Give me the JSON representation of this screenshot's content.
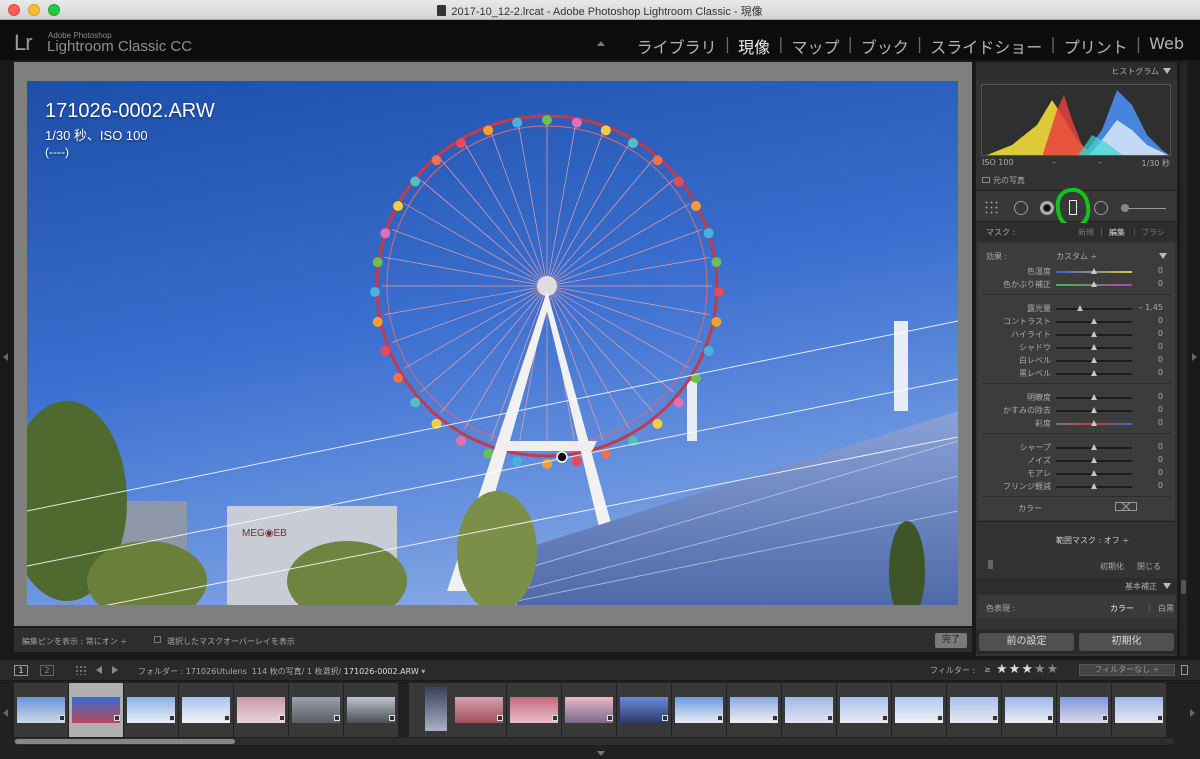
{
  "window": {
    "title": "2017-10_12-2.lrcat - Adobe Photoshop Lightroom Classic - 現像"
  },
  "identity": {
    "logo": "Lr",
    "brand_small": "Adobe Photoshop",
    "brand_big": "Lightroom Classic CC"
  },
  "modules": [
    {
      "label": "ライブラリ",
      "active": false
    },
    {
      "label": "現像",
      "active": true
    },
    {
      "label": "マップ",
      "active": false
    },
    {
      "label": "ブック",
      "active": false
    },
    {
      "label": "スライドショー",
      "active": false
    },
    {
      "label": "プリント",
      "active": false
    },
    {
      "label": "Web",
      "active": false
    }
  ],
  "module_separator": "|",
  "photo_info": {
    "filename": "171026-0002.ARW",
    "exposure": "1/30 秒、ISO 100",
    "extra": "(----)"
  },
  "toolbar": {
    "show_pins_label": "編集ピンを表示 :",
    "show_pins_value": "常にオン",
    "show_pins_arrow": "÷",
    "overlay_label": "選択したマスクオーバーレイを表示",
    "done": "完了"
  },
  "histogram": {
    "header": "ヒストグラム",
    "iso": "ISO 100",
    "dash1": "–",
    "dash2": "–",
    "shutter": "1/30 秒",
    "original": "元の写真"
  },
  "mask": {
    "label": "マスク :",
    "new": "新規",
    "edit": "編集",
    "brush": "ブラシ",
    "separator": "|"
  },
  "effect": {
    "label": "効果 :",
    "value": "カスタム",
    "arrow": "÷"
  },
  "sliders": [
    {
      "label": "色温度",
      "value": "0",
      "pos": 0.5,
      "group": 1
    },
    {
      "label": "色かぶり補正",
      "value": "0",
      "pos": 0.5,
      "group": 1
    },
    {
      "label": "露光量",
      "value": "– 1.45",
      "pos": 0.32,
      "group": 2
    },
    {
      "label": "コントラスト",
      "value": "0",
      "pos": 0.5,
      "group": 2
    },
    {
      "label": "ハイライト",
      "value": "0",
      "pos": 0.5,
      "group": 2
    },
    {
      "label": "シャドウ",
      "value": "0",
      "pos": 0.5,
      "group": 2
    },
    {
      "label": "白レベル",
      "value": "0",
      "pos": 0.5,
      "group": 2
    },
    {
      "label": "黒レベル",
      "value": "0",
      "pos": 0.5,
      "group": 2
    },
    {
      "label": "明瞭度",
      "value": "0",
      "pos": 0.5,
      "group": 3
    },
    {
      "label": "かすみの除去",
      "value": "0",
      "pos": 0.5,
      "group": 3
    },
    {
      "label": "彩度",
      "value": "0",
      "pos": 0.5,
      "group": 3
    },
    {
      "label": "シャープ",
      "value": "0",
      "pos": 0.5,
      "group": 4
    },
    {
      "label": "ノイズ",
      "value": "0",
      "pos": 0.5,
      "group": 4
    },
    {
      "label": "モアレ",
      "value": "0",
      "pos": 0.5,
      "group": 4
    },
    {
      "label": "フリンジ軽減",
      "value": "0",
      "pos": 0.5,
      "group": 4
    }
  ],
  "color": {
    "label": "カラー"
  },
  "range_mask": {
    "label": "範囲マスク : オフ",
    "arrow": "÷",
    "reset": "初期化",
    "close": "閉じる"
  },
  "basic": {
    "header": "基本補正",
    "treatment_label": "色表現 :",
    "color": "カラー",
    "bw": "白黒",
    "separator": "|"
  },
  "buttons": {
    "previous": "前の設定",
    "reset": "初期化"
  },
  "filmstrip": {
    "view1": "1",
    "view2": "2",
    "folder_label": "フォルダー : 171026Utulens",
    "count_text": "114 枚の写真/ 1 枚選択/",
    "current_file": "171026-0002.ARW",
    "dropdown_arrow": "▾",
    "filter_label": "フィルター :",
    "filter_cmp": "≥",
    "rating_stars": 3,
    "stars": "★★★★★",
    "filter_value": "フィルターなし",
    "filter_arrow": "÷"
  },
  "colors": {
    "accent_green": "#12c41a",
    "sky_top": "#1c4fa8",
    "wheel_red": "#c43a4a"
  },
  "icons": [
    "grid-dots-icon",
    "circle-tool-icon",
    "radial-dot-icon",
    "graduated-filter-icon",
    "brush-circle-icon",
    "slider-icon",
    "lock-icon"
  ]
}
